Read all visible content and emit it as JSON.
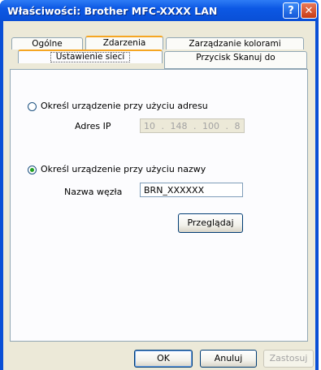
{
  "window": {
    "title": "Właściwości: Brother  MFC-XXXX  LAN",
    "help_glyph": "?",
    "close_glyph": "✕"
  },
  "tabs": {
    "row_top": [
      "Ogólne",
      "Zdarzenia",
      "Zarządzanie kolorami"
    ],
    "row_bottom": [
      "Ustawienie sieci",
      "Przycisk Skanuj do"
    ],
    "selected": "Ustawienie sieci"
  },
  "network": {
    "option_address_label": "Określ urządzenie przy użyciu adresu",
    "ip_label": "Adres IP",
    "ip_value": "10 . 148 . 100 . 8",
    "option_name_label": "Określ urządzenie przy użyciu nazwy",
    "node_label": "Nazwa węzła",
    "node_value": "BRN_XXXXXX",
    "browse_button": "Przeglądaj",
    "selected_option": "name"
  },
  "buttons": {
    "ok": "OK",
    "cancel": "Anuluj",
    "apply": "Zastosuj"
  },
  "colors": {
    "titlebar": "#0a4fd6",
    "dialog": "#ece9d8",
    "tab_highlight": "#f5a623",
    "radio_dot": "#21a121"
  }
}
